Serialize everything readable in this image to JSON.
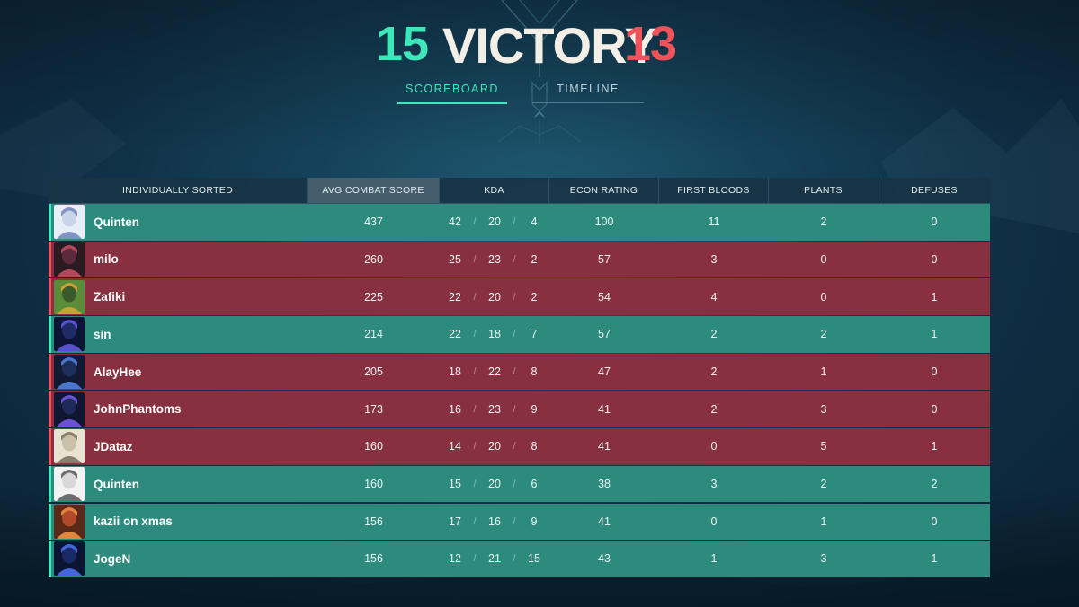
{
  "header": {
    "team_score": "15",
    "result": "VICTORY",
    "enemy_score": "13"
  },
  "tabs": [
    {
      "label": "SCOREBOARD",
      "active": true
    },
    {
      "label": "TIMELINE",
      "active": false
    }
  ],
  "colors": {
    "win_row": "#2c8b7d",
    "loss_row": "#88303f",
    "accent_green": "#3ee6b9",
    "accent_red": "#f0525a"
  },
  "scoreboard": {
    "columns": [
      "INDIVIDUALLY SORTED",
      "AVG COMBAT SCORE",
      "KDA",
      "ECON RATING",
      "FIRST BLOODS",
      "PLANTS",
      "DEFUSES"
    ],
    "sorted_column": "AVG COMBAT SCORE",
    "rows": [
      {
        "name": "Quinten",
        "team": "win",
        "acs": "437",
        "k": "42",
        "d": "20",
        "a": "4",
        "econ": "100",
        "fb": "11",
        "plants": "2",
        "defuses": "0"
      },
      {
        "name": "milo",
        "team": "loss",
        "acs": "260",
        "k": "25",
        "d": "23",
        "a": "2",
        "econ": "57",
        "fb": "3",
        "plants": "0",
        "defuses": "0"
      },
      {
        "name": "Zafiki",
        "team": "loss",
        "acs": "225",
        "k": "22",
        "d": "20",
        "a": "2",
        "econ": "54",
        "fb": "4",
        "plants": "0",
        "defuses": "1"
      },
      {
        "name": "sin",
        "team": "win",
        "acs": "214",
        "k": "22",
        "d": "18",
        "a": "7",
        "econ": "57",
        "fb": "2",
        "plants": "2",
        "defuses": "1"
      },
      {
        "name": "AlayHee",
        "team": "loss",
        "acs": "205",
        "k": "18",
        "d": "22",
        "a": "8",
        "econ": "47",
        "fb": "2",
        "plants": "1",
        "defuses": "0"
      },
      {
        "name": "JohnPhantoms",
        "team": "loss",
        "acs": "173",
        "k": "16",
        "d": "23",
        "a": "9",
        "econ": "41",
        "fb": "2",
        "plants": "3",
        "defuses": "0"
      },
      {
        "name": "JDataz",
        "team": "loss",
        "acs": "160",
        "k": "14",
        "d": "20",
        "a": "8",
        "econ": "41",
        "fb": "0",
        "plants": "5",
        "defuses": "1"
      },
      {
        "name": "Quinten",
        "team": "win",
        "acs": "160",
        "k": "15",
        "d": "20",
        "a": "6",
        "econ": "38",
        "fb": "3",
        "plants": "2",
        "defuses": "2"
      },
      {
        "name": "kazii on xmas",
        "team": "win",
        "acs": "156",
        "k": "17",
        "d": "16",
        "a": "9",
        "econ": "41",
        "fb": "0",
        "plants": "1",
        "defuses": "0"
      },
      {
        "name": "JogeN",
        "team": "win",
        "acs": "156",
        "k": "12",
        "d": "21",
        "a": "15",
        "econ": "43",
        "fb": "1",
        "plants": "3",
        "defuses": "1"
      }
    ]
  }
}
